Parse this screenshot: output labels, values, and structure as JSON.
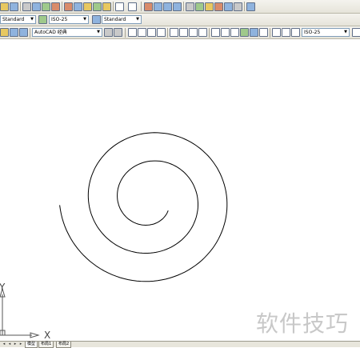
{
  "toolbars": {
    "text_style": "Standard",
    "dim_style_1": "ISO-25",
    "table_style": "Standard",
    "workspace": "AutoCAD 经典",
    "dim_style_2": "ISO-25"
  },
  "ucs": {
    "x_label": "X",
    "y_label": "Y"
  },
  "tabs": [
    {
      "label": "模型",
      "active": true
    },
    {
      "label": "布局1",
      "active": false
    },
    {
      "label": "布局2",
      "active": false
    }
  ],
  "watermark": "软件技巧",
  "drawing": {
    "entity": "spiral",
    "color": "#000000"
  }
}
